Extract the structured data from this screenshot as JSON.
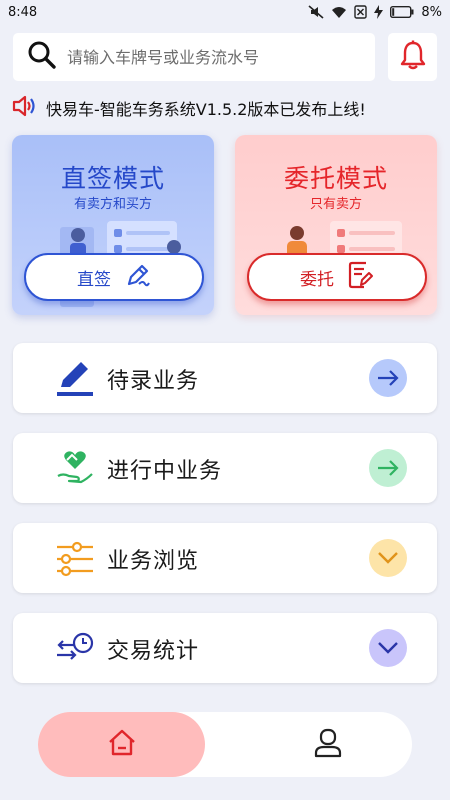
{
  "status_bar": {
    "time": "8:48",
    "battery": "8%",
    "icons": [
      "mute-icon",
      "wifi-icon",
      "no-sim-icon",
      "charging-icon",
      "battery-icon"
    ]
  },
  "search": {
    "placeholder": "请输入车牌号或业务流水号",
    "value": ""
  },
  "announcement": {
    "text": "快易车-智能车务系统V1.5.2版本已发布上线!"
  },
  "modes": {
    "direct": {
      "title": "直签模式",
      "subtitle": "有卖方和买方",
      "button_label": "直签"
    },
    "entrust": {
      "title": "委托模式",
      "subtitle": "只有卖方",
      "button_label": "委托"
    }
  },
  "menu": [
    {
      "label": "待录业务",
      "icon": "pen-icon",
      "arrow": "arrow-right-icon"
    },
    {
      "label": "进行中业务",
      "icon": "hand-heart-icon",
      "arrow": "arrow-right-icon"
    },
    {
      "label": "业务浏览",
      "icon": "sliders-icon",
      "arrow": "chevron-down-icon"
    },
    {
      "label": "交易统计",
      "icon": "exchange-clock-icon",
      "arrow": "chevron-down-icon"
    }
  ],
  "bottom_nav": {
    "items": [
      "home-icon",
      "user-icon"
    ],
    "active": "home-icon"
  },
  "colors": {
    "background": "#eef0f8",
    "direct_accent": "#2548c9",
    "entrust_accent": "#e5252a",
    "bell": "#e0262b",
    "pen_icon": "#2442b8",
    "progress_icon": "#2fb361",
    "browse_icon": "#f29c1f",
    "stats_icon": "#2a35a8",
    "home_active_bg": "#ffbcbc"
  }
}
